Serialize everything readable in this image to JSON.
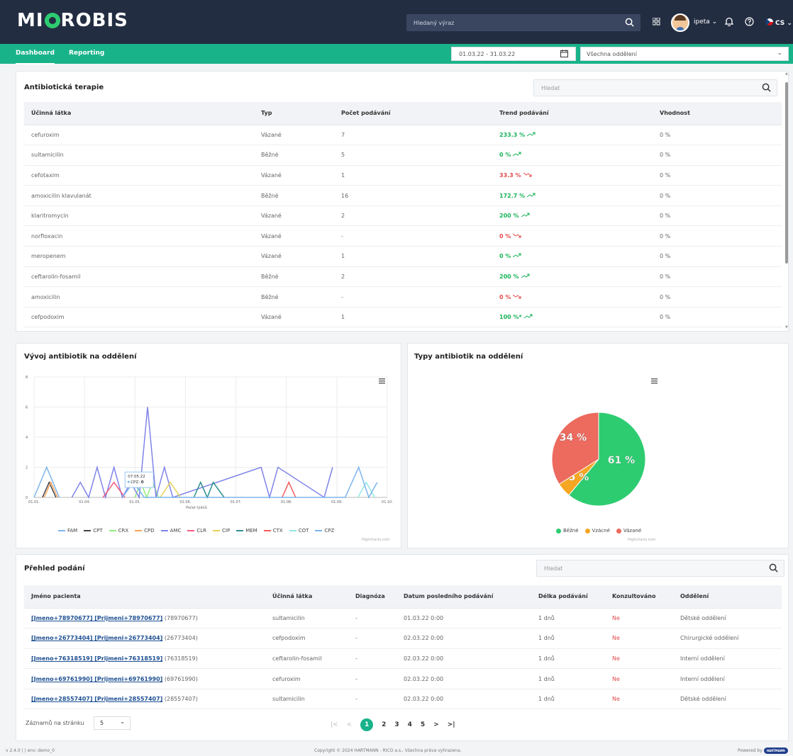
{
  "app": {
    "logo": "MI ROBIS"
  },
  "header": {
    "search_placeholder": "Hledaný výraz",
    "user": "ipeta",
    "lang": "CS"
  },
  "nav": {
    "tabs": [
      {
        "label": "Dashboard",
        "active": true
      },
      {
        "label": "Reporting",
        "active": false
      }
    ],
    "date_range": "01.03.22 - 31.03.22",
    "department": "Všechna oddělení"
  },
  "therapy": {
    "title": "Antibiotická terapie",
    "search_placeholder": "Hledat",
    "columns": [
      "Účinná látka",
      "Typ",
      "Počet podávání",
      "Trend podávání",
      "Vhodnost"
    ],
    "rows": [
      {
        "name": "cefuroxim",
        "type": "Vázané",
        "count": "7",
        "trend": "233.3 %",
        "dir": "up",
        "fit": "0 %"
      },
      {
        "name": "sultamicilin",
        "type": "Běžné",
        "count": "5",
        "trend": "0 %",
        "dir": "up",
        "fit": "0 %"
      },
      {
        "name": "cefotaxim",
        "type": "Vázané",
        "count": "1",
        "trend": "33.3 %",
        "dir": "down",
        "fit": "0 %"
      },
      {
        "name": "amoxicilin klavulanát",
        "type": "Běžné",
        "count": "16",
        "trend": "172.7 %",
        "dir": "up",
        "fit": "0 %"
      },
      {
        "name": "klaritromycin",
        "type": "Vázané",
        "count": "2",
        "trend": "200 %",
        "dir": "up",
        "fit": "0 %"
      },
      {
        "name": "norfloxacin",
        "type": "Vázané",
        "count": "-",
        "trend": "0 %",
        "dir": "down",
        "fit": "0 %"
      },
      {
        "name": "meropenem",
        "type": "Vázané",
        "count": "1",
        "trend": "0 %",
        "dir": "up",
        "fit": "0 %"
      },
      {
        "name": "ceftarolin-fosamil",
        "type": "Běžné",
        "count": "2",
        "trend": "200 %",
        "dir": "up",
        "fit": "0 %"
      },
      {
        "name": "amoxicilin",
        "type": "Běžné",
        "count": "-",
        "trend": "0 %",
        "dir": "down",
        "fit": "0 %"
      },
      {
        "name": "cefpodoxim",
        "type": "Vázané",
        "count": "1",
        "trend": "100 %*",
        "dir": "up",
        "fit": "0 %"
      }
    ]
  },
  "colors": {
    "accent": "#19b38a",
    "topbar": "#232d42",
    "up": "#19b35a",
    "down": "#e14b4b"
  },
  "chart_data": [
    {
      "type": "line",
      "title": "Vývoj antibiotik na oddělení",
      "xlabel": "Počet týdnů",
      "x_tick_labels": [
        "01.01.",
        "01.04.",
        "01.05.",
        "01.06.",
        "01.07.",
        "01.08.",
        "01.09.",
        "01.10."
      ],
      "ylim": [
        0,
        8
      ],
      "y_ticks": [
        0,
        2,
        4,
        6,
        8
      ],
      "grid": true,
      "legend": "bottom",
      "tooltip": {
        "date": "07.05.22",
        "series": "CPZ",
        "value": "0"
      },
      "credits": "Highcharts.com",
      "series": [
        {
          "name": "FAM",
          "color": "#7cb5ec",
          "x": [
            0,
            1.5,
            3
          ],
          "values": [
            0,
            2,
            0
          ]
        },
        {
          "name": "CPT",
          "color": "#434348",
          "x": [
            1,
            1.8,
            2.6
          ],
          "values": [
            0,
            1,
            0
          ]
        },
        {
          "name": "CRX",
          "color": "#90ed7d",
          "x": [
            12,
            12.7,
            13.4,
            14.1,
            14.8
          ],
          "values": [
            0,
            1,
            0,
            1,
            0
          ]
        },
        {
          "name": "CPD",
          "color": "#f7a35c",
          "x": [
            1.2,
            2,
            2.8
          ],
          "values": [
            0,
            1,
            0
          ]
        },
        {
          "name": "AMC",
          "color": "#8085e9",
          "x": [
            4.5,
            5.5,
            6.5,
            7.5,
            8.5,
            9.5,
            10.5,
            11.5,
            12.5,
            13.5,
            14.5,
            15.5,
            16.5,
            27,
            28,
            29,
            34.5,
            35.5
          ],
          "values": [
            0,
            1,
            0,
            2,
            0,
            2,
            0,
            1,
            0,
            6,
            0,
            2,
            0,
            2,
            0,
            2,
            0,
            2
          ]
        },
        {
          "name": "CLR",
          "color": "#f15c80",
          "x": [
            8.2,
            9.5,
            10.8
          ],
          "values": [
            0,
            1,
            0
          ]
        },
        {
          "name": "CIP",
          "color": "#e4d354",
          "x": [
            15,
            16.2,
            17.4
          ],
          "values": [
            0,
            1,
            0
          ]
        },
        {
          "name": "MEM",
          "color": "#2b908f",
          "x": [
            19,
            19.8,
            20.6,
            21.3,
            22.6
          ],
          "values": [
            0,
            1,
            0,
            1,
            0
          ]
        },
        {
          "name": "CTX",
          "color": "#f45b5b",
          "x": [
            29.5,
            30.3,
            31.1
          ],
          "values": [
            0,
            1,
            0
          ]
        },
        {
          "name": "COT",
          "color": "#91e8e1",
          "x": [
            38.5,
            39.5,
            40.5
          ],
          "values": [
            0,
            1,
            0
          ]
        },
        {
          "name": "CPZ",
          "color": "#7cb5ec",
          "x": [
            10.5,
            11.8,
            13.1,
            37,
            38.6,
            39.8,
            40.8
          ],
          "values": [
            0,
            1,
            0,
            0,
            2,
            0,
            1
          ]
        }
      ]
    },
    {
      "type": "pie",
      "title": "Typy antibiotik na oddělení",
      "legend": "bottom",
      "credits": "Highcharts.com",
      "slices": [
        {
          "name": "Běžné",
          "value": 61,
          "label": "61 %",
          "color": "#2ecc71"
        },
        {
          "name": "Vzácné",
          "value": 5,
          "label": "5 %",
          "color": "#f5a623"
        },
        {
          "name": "Vázané",
          "value": 34,
          "label": "34 %",
          "color": "#ec6a5e"
        }
      ]
    }
  ],
  "overview": {
    "title": "Přehled podání",
    "search_placeholder": "Hledat",
    "columns": [
      "Jméno pacienta",
      "Účinná látka",
      "Diagnóza",
      "Datum posledního podávání",
      "Délka podávání",
      "Konzultováno",
      "Oddělení"
    ],
    "rows": [
      {
        "patient": "[Jmeno+78970677] [Prijmeni+78970677]",
        "id": "(78970677)",
        "drug": "sultamicilin",
        "diagnosis": "-",
        "date": "01.03.22 0:00",
        "length": "1 dnů",
        "consulted": "Ne",
        "dept": "Dětské oddělení"
      },
      {
        "patient": "[Jmeno+26773404] [Prijmeni+26773404]",
        "id": "(26773404)",
        "drug": "cefpodoxim",
        "diagnosis": "-",
        "date": "02.03.22 0:00",
        "length": "1 dnů",
        "consulted": "Ne",
        "dept": "Chirurgické oddělení"
      },
      {
        "patient": "[Jmeno+76318519] [Prijmeni+76318519]",
        "id": "(76318519)",
        "drug": "ceftarolin-fosamil",
        "diagnosis": "-",
        "date": "02.03.22 0:00",
        "length": "1 dnů",
        "consulted": "Ne",
        "dept": "Interní oddělení"
      },
      {
        "patient": "[Jmeno+69761990] [Prijmeni+69761990]",
        "id": "(69761990)",
        "drug": "cefuroxim",
        "diagnosis": "-",
        "date": "02.03.22 0:00",
        "length": "1 dnů",
        "consulted": "Ne",
        "dept": "Interní oddělení"
      },
      {
        "patient": "[Jmeno+28557407] [Prijmeni+28557407]",
        "id": "(28557407)",
        "drug": "sultamicilin",
        "diagnosis": "-",
        "date": "02.03.22 0:00",
        "length": "1 dnů",
        "consulted": "Ne",
        "dept": "Dětské oddělení"
      }
    ],
    "per_page_label": "Záznamů na stránku",
    "per_page_value": "5",
    "pages": [
      "1",
      "2",
      "3",
      "4",
      "5"
    ],
    "current_page": "1"
  },
  "footer": {
    "version": "v 2.4.0 | | env: demo_0",
    "copyright": "Copyright © 2024 HARTMANN - RICO a.s., Všechna práva vyhrazena.",
    "powered": "Powered by",
    "powered_logo": "HARTMANN"
  }
}
